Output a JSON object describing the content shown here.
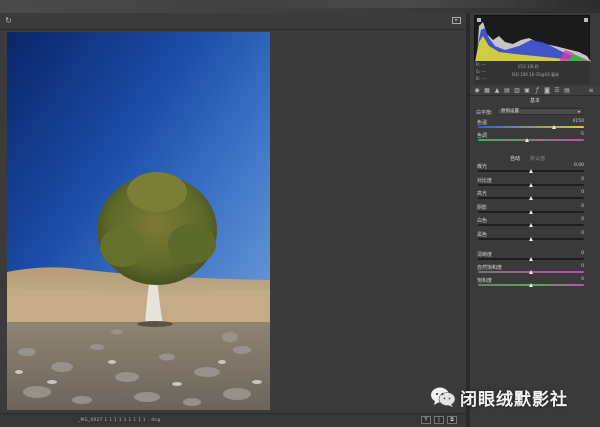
{
  "toolbar": {
    "rotate_icon": "rotate-icon",
    "fullscreen_icon": "fullscreen-icon"
  },
  "status": {
    "filename": "_MG_0027 1 1 1 1 1 1 1 1 1 . dng"
  },
  "bottom_buttons": [
    "Y",
    "|",
    "⧉"
  ],
  "info": {
    "r": "R:  ---",
    "g": "G:  ---",
    "b": "B:  ---",
    "aperture_shutter": "f/13   1/8 秒",
    "iso_lens": "ISO 100   16-35@16 毫米"
  },
  "panel": {
    "section_title": "基本",
    "white_balance_label": "白平衡:",
    "white_balance_value": "原照设置",
    "sliders_top": [
      {
        "label": "色温",
        "value": "4150",
        "pos": 0.72
      },
      {
        "label": "色调",
        "value": "-5",
        "pos": 0.46
      }
    ],
    "auto_label": "自动",
    "default_label": "默认值",
    "sliders_tone": [
      {
        "label": "曝光",
        "value": "0.00",
        "pos": 0.5
      },
      {
        "label": "对比度",
        "value": "0",
        "pos": 0.5
      },
      {
        "label": "高光",
        "value": "0",
        "pos": 0.5
      },
      {
        "label": "阴影",
        "value": "0",
        "pos": 0.5
      },
      {
        "label": "白色",
        "value": "0",
        "pos": 0.5
      },
      {
        "label": "黑色",
        "value": "0",
        "pos": 0.5
      }
    ],
    "sliders_presence": [
      {
        "label": "清晰度",
        "value": "0",
        "pos": 0.5
      },
      {
        "label": "自然饱和度",
        "value": "0",
        "pos": 0.5
      },
      {
        "label": "饱和度",
        "value": "0",
        "pos": 0.5
      }
    ]
  },
  "panel_tabs": [
    "basic-tab-icon",
    "tone-curve-tab-icon",
    "detail-tab-icon",
    "hsl-tab-icon",
    "split-toning-tab-icon",
    "lens-tab-icon",
    "fx-tab-icon",
    "camera-calibration-tab-icon",
    "presets-tab-icon",
    "snapshots-tab-icon"
  ],
  "watermark": {
    "text": "闭眼绒默影社"
  },
  "colors": {
    "accent": "#3b3b3b",
    "panel": "#3a3a3a",
    "canvas": "#3c3b3c"
  }
}
